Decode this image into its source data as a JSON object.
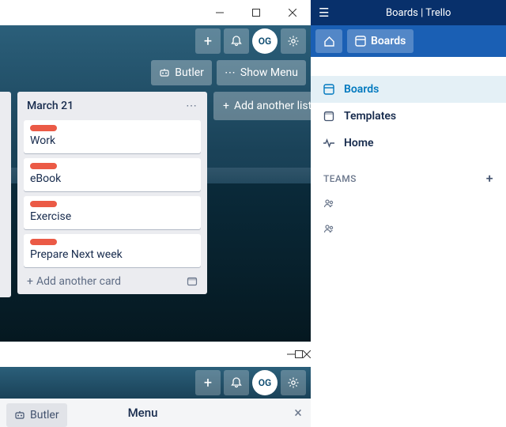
{
  "window1": {
    "titlebar_buttons": [
      "minimize",
      "maximize",
      "close"
    ],
    "topbar": {
      "avatar": "OG"
    },
    "actions": {
      "butler": "Butler",
      "show_menu": "Show Menu"
    },
    "list": {
      "title": "March 21",
      "cards": [
        "Work",
        "eBook",
        "Exercise",
        "Prepare Next week"
      ],
      "add_card": "Add another card"
    },
    "add_list": "Add another list"
  },
  "window2": {
    "topbar": {
      "avatar": "OG"
    },
    "butler": "Butler",
    "menu_title": "Menu"
  },
  "sidebar": {
    "title": "Boards | Trello",
    "nav_boards": "Boards",
    "items": [
      {
        "icon": "board",
        "label": "Boards"
      },
      {
        "icon": "template",
        "label": "Templates"
      },
      {
        "icon": "pulse",
        "label": "Home"
      }
    ],
    "teams_label": "TEAMS"
  }
}
